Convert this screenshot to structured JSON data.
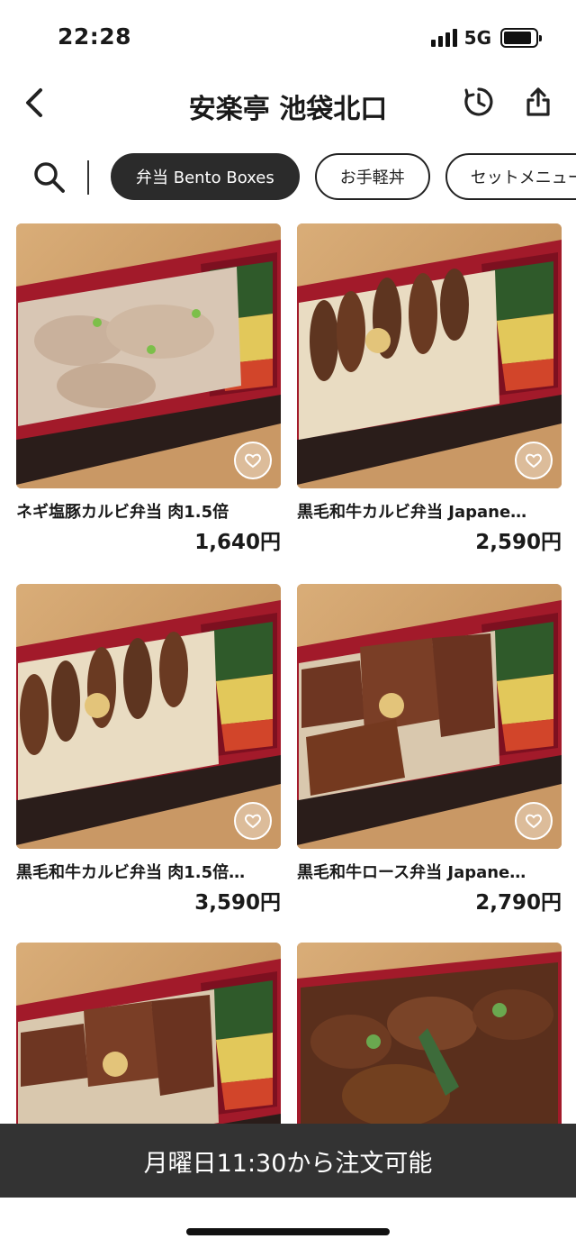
{
  "status": {
    "time": "22:28",
    "network": "5G"
  },
  "header": {
    "title": "安楽亭 池袋北口"
  },
  "categories": [
    {
      "label": "弁当 Bento Boxes",
      "active": true
    },
    {
      "label": "お手軽丼",
      "active": false
    },
    {
      "label": "セットメニュー",
      "active": false
    }
  ],
  "items": [
    {
      "name": "ネギ塩豚カルビ弁当 肉1.5倍",
      "price": "1,640円",
      "image": "pork-kalbi-negi-shio-bento"
    },
    {
      "name": "黒毛和牛カルビ弁当 Japane…",
      "price": "2,590円",
      "image": "wagyu-kalbi-bento"
    },
    {
      "name": "黒毛和牛カルビ弁当 肉1.5倍…",
      "price": "3,590円",
      "image": "wagyu-kalbi-bento-large"
    },
    {
      "name": "黒毛和牛ロース弁当 Japane…",
      "price": "2,790円",
      "image": "wagyu-loin-bento"
    },
    {
      "name": "",
      "price": "",
      "image": "wagyu-loin-bento-large"
    },
    {
      "name": "",
      "price": "",
      "image": "beef-bowl-bento"
    }
  ],
  "banner": {
    "text": "月曜日11:30から注文可能"
  },
  "colors": {
    "accent_dark": "#2b2b2b",
    "banner": "#333333",
    "tray_red": "#a21a2a"
  }
}
